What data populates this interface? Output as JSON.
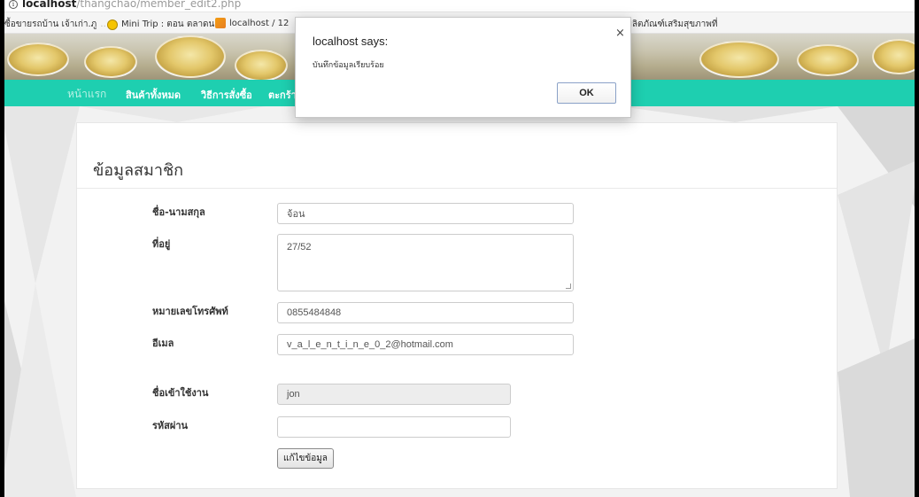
{
  "browser": {
    "url_host": "localhost",
    "url_path": "/thangchao/member_edit2.php",
    "bookmarks": [
      {
        "label": "อซื้อขายรถบ้าน เจ้าเก่า.ภู",
        "icon": "none"
      },
      {
        "label": "Mini Trip : ตอน ตลาดน",
        "icon": "smiley-icon"
      },
      {
        "label": "localhost / 12",
        "icon": "phpmyadmin-icon"
      },
      {
        "label": "ผลิตภัณฑ์เสริมสุขภาพที่",
        "icon": "none"
      }
    ]
  },
  "nav": {
    "items": [
      "หน้าแรก",
      "สินค้าทั้งหมด",
      "วิธีการสั่งซื้อ",
      "ตะกร้า"
    ]
  },
  "form": {
    "title": "ข้อมูลสมาชิก",
    "fields": {
      "name_label": "ชื่อ-นามสกุล",
      "name_value": "จ้อน",
      "address_label": "ที่อยู่",
      "address_value": "27/52",
      "phone_label": "หมายเลขโทรศัพท์",
      "phone_value": "0855484848",
      "email_label": "อีเมล",
      "email_value": "v_a_l_e_n_t_i_n_e_0_2@hotmail.com",
      "username_label": "ชื่อเข้าใช้งาน",
      "username_value": "jon",
      "password_label": "รหัสผ่าน",
      "password_value": ""
    },
    "submit_label": "แก้ไขข้อมูล"
  },
  "dialog": {
    "title": "localhost says:",
    "message": "บันทึกข้อมูลเรียบร้อย",
    "ok_label": "OK",
    "close_glyph": "×"
  },
  "colors": {
    "nav_bg": "#1ecfb0",
    "page_bg": "#f2f2f2"
  }
}
